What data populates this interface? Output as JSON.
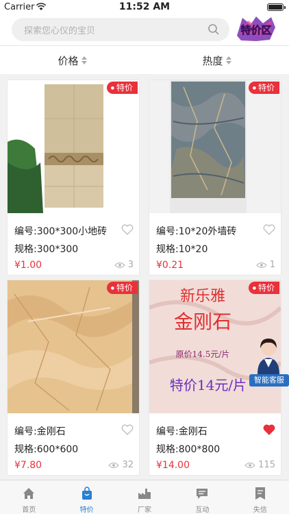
{
  "status_bar": {
    "carrier": "Carrier",
    "time": "11:52 AM"
  },
  "search": {
    "placeholder": "探索您心仪的宝贝"
  },
  "promo_logo": {
    "text": "特价区"
  },
  "sort": [
    {
      "label": "价格"
    },
    {
      "label": "热度"
    }
  ],
  "products": [
    {
      "tag": "特价",
      "code": "编号:300*300小地砖",
      "spec": "规格:300*300",
      "price": "¥1.00",
      "views": "3",
      "favorited": false
    },
    {
      "tag": "特价",
      "code": "编号:10*20外墙砖",
      "spec": "规格:10*20",
      "price": "¥0.21",
      "views": "1",
      "favorited": false
    },
    {
      "tag": "特价",
      "code": "编号:金刚石",
      "spec": "规格:600*600",
      "price": "¥7.80",
      "views": "32",
      "favorited": false
    },
    {
      "tag": "特价",
      "code": "编号:金刚石",
      "spec": "规格:800*800",
      "price": "¥14.00",
      "views": "115",
      "favorited": true,
      "image_text": {
        "line1": "新乐雅",
        "line2": "金刚石",
        "line3": "原价14.5元/片",
        "line4": "特价14元/片"
      }
    }
  ],
  "service": {
    "label": "智能客服"
  },
  "tabs": [
    {
      "label": "首页",
      "icon": "home-icon",
      "active": false
    },
    {
      "label": "特价",
      "icon": "shopping-bag-icon",
      "active": true
    },
    {
      "label": "厂家",
      "icon": "factory-icon",
      "active": false
    },
    {
      "label": "互动",
      "icon": "chat-icon",
      "active": false
    },
    {
      "label": "失信",
      "icon": "document-icon",
      "active": false
    }
  ],
  "colors": {
    "accent": "#e8313b",
    "tab_active": "#2a7fd4",
    "service": "#2a6fbf"
  }
}
